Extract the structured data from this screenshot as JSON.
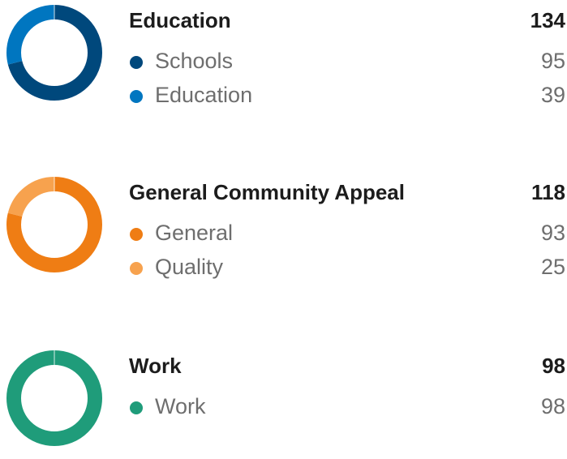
{
  "chart_data": [
    {
      "type": "pie",
      "title": "Education",
      "total": "134",
      "series": [
        {
          "name": "Schools",
          "value": 95,
          "color": "#00487c"
        },
        {
          "name": "Education",
          "value": 39,
          "color": "#0076c0"
        }
      ]
    },
    {
      "type": "pie",
      "title": "General Community Appeal",
      "total": "118",
      "series": [
        {
          "name": "General",
          "value": 93,
          "color": "#ef7d14"
        },
        {
          "name": "Quality",
          "value": 25,
          "color": "#f7a24e"
        }
      ]
    },
    {
      "type": "pie",
      "title": "Work",
      "total": "98",
      "series": [
        {
          "name": "Work",
          "value": 98,
          "color": "#1f9c7a"
        }
      ]
    }
  ]
}
